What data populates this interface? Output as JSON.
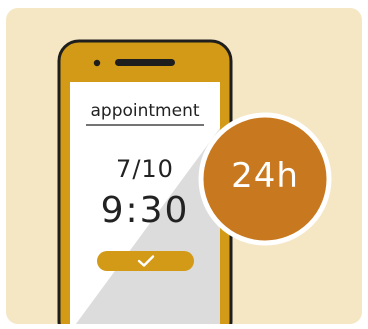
{
  "reminder": {
    "title": "appointment",
    "date": "7/10",
    "time": "9:30",
    "badge": "24h"
  },
  "icons": {
    "confirm": "check-icon",
    "speaker": "speaker-icon",
    "camera": "camera-icon"
  },
  "colors": {
    "background": "#F5E6C4",
    "phone_frame": "#D29A16",
    "badge": "#C8781E",
    "screen": "#FFFFFF",
    "screen_shade": "#DCDCDC",
    "text": "#222222"
  }
}
